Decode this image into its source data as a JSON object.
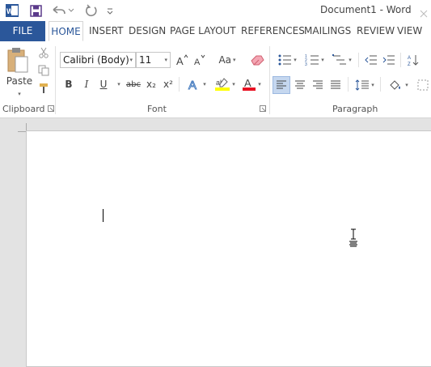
{
  "window": {
    "title": "Document1 - Word"
  },
  "tabs": [
    {
      "label": "FILE"
    },
    {
      "label": "HOME"
    },
    {
      "label": "INSERT"
    },
    {
      "label": "DESIGN"
    },
    {
      "label": "PAGE LAYOUT"
    },
    {
      "label": "REFERENCES"
    },
    {
      "label": "MAILINGS"
    },
    {
      "label": "REVIEW"
    },
    {
      "label": "VIEW"
    }
  ],
  "clipboard": {
    "paste_label": "Paste",
    "group_label": "Clipboard"
  },
  "font": {
    "font_name": "Calibri (Body)",
    "font_size": "11",
    "group_label": "Font",
    "change_case_label": "Aa",
    "bold_label": "B",
    "italic_label": "I",
    "underline_label": "U",
    "strikethrough_label": "abc",
    "subscript_label": "x₂",
    "superscript_label": "x²"
  },
  "paragraph": {
    "group_label": "Paragraph"
  },
  "colors": {
    "file_tab": "#2b579a",
    "highlight": "#ffff00",
    "font_color": "#e81123"
  }
}
